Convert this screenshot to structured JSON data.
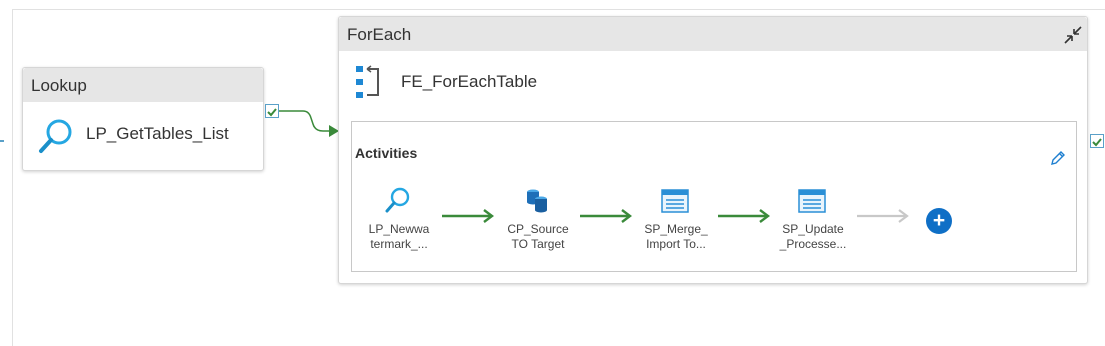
{
  "lookup": {
    "type_label": "Lookup",
    "name": "LP_GetTables_List"
  },
  "foreach": {
    "type_label": "ForEach",
    "name": "FE_ForEachTable",
    "activities_title": "Activities",
    "activities": [
      {
        "icon": "lookup-icon",
        "label_line1": "LP_Newwa",
        "label_line2": "termark_..."
      },
      {
        "icon": "copy-database-icon",
        "label_line1": "CP_Source",
        "label_line2": "TO Target"
      },
      {
        "icon": "stored-procedure-icon",
        "label_line1": "SP_Merge_",
        "label_line2": "Import To..."
      },
      {
        "icon": "stored-procedure-icon",
        "label_line1": "SP_Update",
        "label_line2": "_Processe..."
      }
    ],
    "add_button_label": "+"
  },
  "colors": {
    "success_green": "#3a8a3a",
    "accent_blue": "#0f6fc6",
    "header_gray": "#e6e6e6",
    "icon_cyan": "#25a7e2"
  }
}
